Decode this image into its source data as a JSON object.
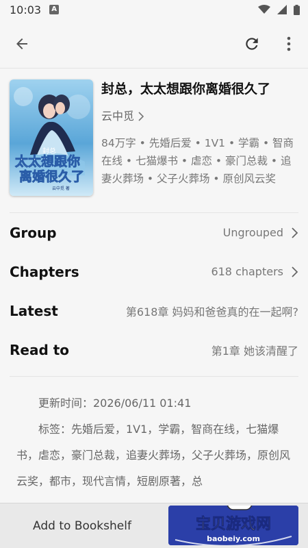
{
  "status_bar": {
    "time": "10:03",
    "notif_letter": "A"
  },
  "toolbar": {
    "back_icon": "arrow-left-icon",
    "refresh_icon": "refresh-icon",
    "more_icon": "more-vert-icon"
  },
  "book": {
    "title": "封总，太太想跟你离婚很久了",
    "author": "云中觅",
    "tags": "84万字 • 先婚后爱 • 1V1 • 学霸 • 智商在线 • 七猫爆书 • 虐恋 • 豪门总裁 • 追妻火葬场 • 父子火葬场 • 原创风云奖",
    "cover_text_top": "封总",
    "cover_text_main_1": "太太想跟你",
    "cover_text_main_2": "离婚很久了",
    "cover_author": "云中觅 著"
  },
  "rows": [
    {
      "label": "Group",
      "value": "Ungrouped"
    },
    {
      "label": "Chapters",
      "value": "618 chapters"
    },
    {
      "label": "Latest",
      "value": "第618章  妈妈和爸爸真的在一起啊?"
    },
    {
      "label": "Read to",
      "value": "第1章  她该清醒了"
    }
  ],
  "description": {
    "updated": "更新时间：2026/06/11 01:41",
    "tags": "标签：先婚后爱，1V1，学霸，智商在线，七猫爆书，虐恋，豪门总裁，追妻火葬场，父子火葬场，原创风云奖，都市，现代言情，短剧原著，总"
  },
  "bottom": {
    "add_to_bookshelf": "Add to Bookshelf"
  },
  "watermark": {
    "text": "宝贝游戏网",
    "url": "baobeiy.com"
  },
  "colors": {
    "background": "#f6f6f6",
    "bottom_bar": "#e9e9e9",
    "watermark_bg": "#2b3fa8"
  }
}
